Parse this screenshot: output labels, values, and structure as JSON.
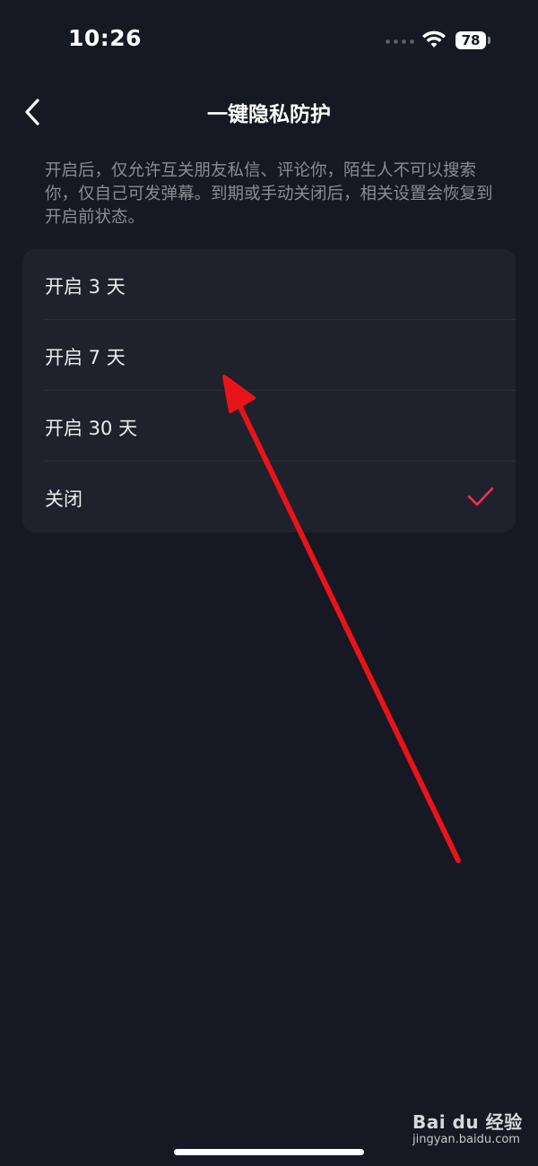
{
  "status_bar": {
    "time": "10:26",
    "battery": "78"
  },
  "header": {
    "title": "一键隐私防护"
  },
  "description": "开启后，仅允许互关朋友私信、评论你，陌生人不可以搜索你，仅自己可发弹幕。到期或手动关闭后，相关设置会恢复到开启前状态。",
  "options": [
    {
      "label": "开启 3 天",
      "selected": false
    },
    {
      "label": "开启 7 天",
      "selected": false
    },
    {
      "label": "开启 30 天",
      "selected": false
    },
    {
      "label": "关闭",
      "selected": true
    }
  ],
  "watermark": {
    "logo": "Bai du 经验",
    "url": "jingyan.baidu.com"
  },
  "colors": {
    "background": "#161823",
    "card": "#1f212c",
    "check": "#fe2c55",
    "annotation_arrow": "#e8141a"
  },
  "icons": [
    "back-chevron-icon",
    "wifi-icon",
    "battery-icon",
    "checkmark-icon"
  ]
}
